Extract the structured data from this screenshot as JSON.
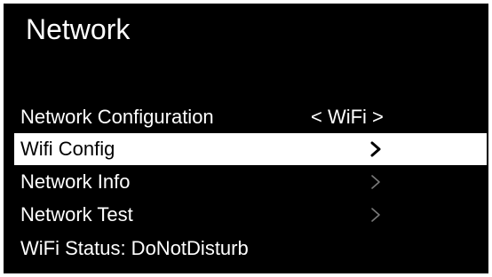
{
  "screen": {
    "title": "Network"
  },
  "menu": {
    "items": [
      {
        "label": "Network Configuration",
        "value": "< WiFi >",
        "selected": false
      },
      {
        "label": "Wifi Config",
        "icon": "chevron-right-icon",
        "selected": true
      },
      {
        "label": "Network Info",
        "icon": "chevron-right-icon",
        "selected": false
      },
      {
        "label": "Network Test",
        "icon": "chevron-right-icon",
        "selected": false
      },
      {
        "label": "WiFi Status: DoNotDisturb",
        "selected": false
      }
    ]
  },
  "colors": {
    "background": "#000000",
    "text": "#ffffff",
    "selected_background": "#ffffff",
    "selected_text": "#000000",
    "chevron_dim": "#7a7a7a"
  }
}
